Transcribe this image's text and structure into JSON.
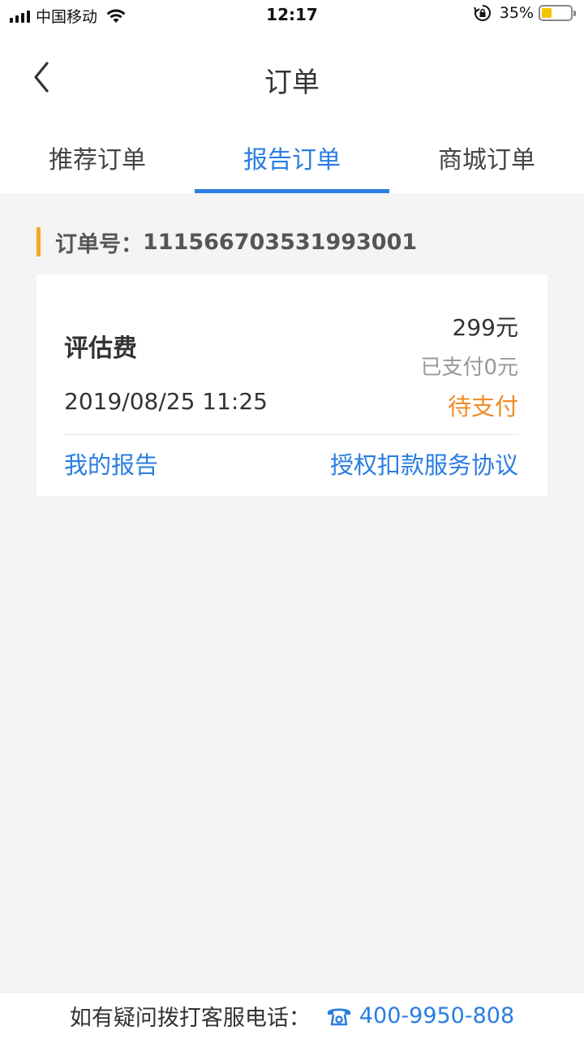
{
  "status_bar": {
    "carrier": "中国移动",
    "time": "12:17",
    "battery": "35%",
    "battery_level": 0.35
  },
  "nav": {
    "title": "订单"
  },
  "tabs": [
    {
      "label": "推荐订单",
      "active": false
    },
    {
      "label": "报告订单",
      "active": true
    },
    {
      "label": "商城订单",
      "active": false
    }
  ],
  "order": {
    "label": "订单号：",
    "number": "111566703531993001",
    "item_name": "评估费",
    "price": "299元",
    "paid": "已支付0元",
    "date": "2019/08/25 11:25",
    "status": "待支付",
    "link_report": "我的报告",
    "link_agreement": "授权扣款服务协议"
  },
  "footer": {
    "text": "如有疑问拨打客服电话：",
    "phone": "400-9950-808"
  },
  "colors": {
    "accent": "#2a7de1",
    "pending": "#f08c28",
    "order_bar": "#f5a623"
  },
  "icons": {
    "back": "chevron-left-icon",
    "phone": "telephone-icon",
    "wifi": "wifi-icon",
    "signal": "signal-icon",
    "battery": "battery-icon",
    "rotation_lock": "rotation-lock-icon"
  }
}
